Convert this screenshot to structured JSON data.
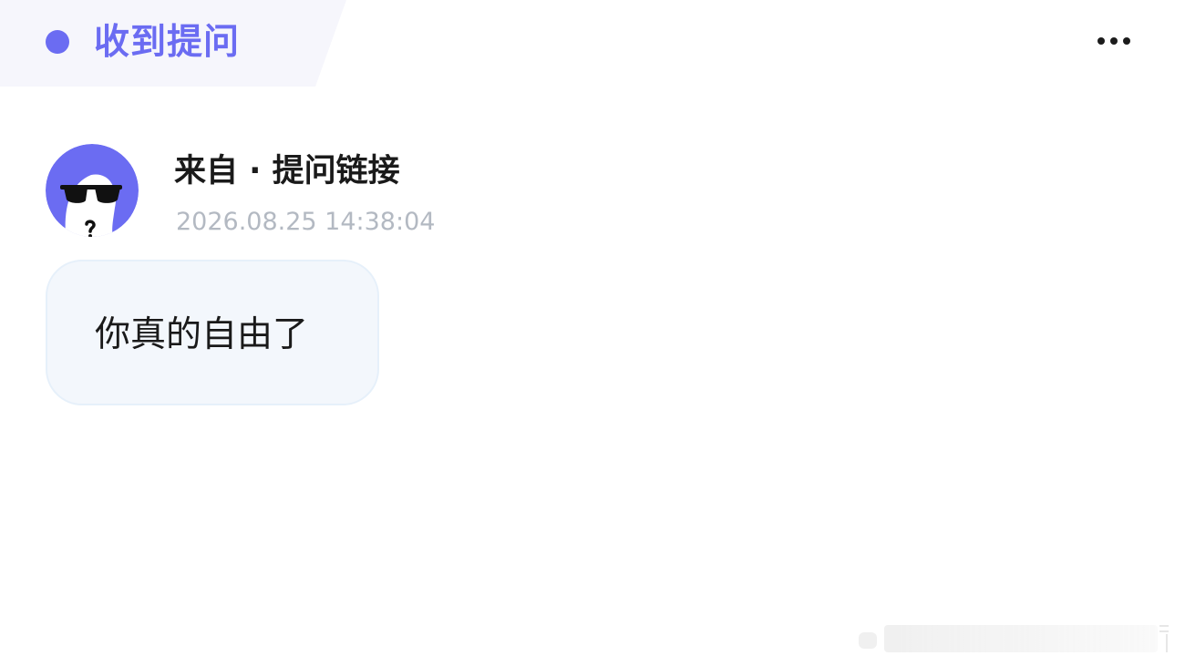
{
  "header": {
    "title": "收到提问",
    "more_icon": "more-horizontal-icon"
  },
  "message": {
    "avatar_icon": "sunglasses-question-avatar",
    "source": "来自 · 提问链接",
    "timestamp": "2026.08.25 14:38:04",
    "text": "你真的自由了"
  },
  "colors": {
    "accent": "#6b6cf2",
    "header_bg": "#f6f6fc",
    "bubble_bg": "#f3f7fc",
    "bubble_border": "#e6f0fa",
    "timestamp": "#b3b9c2",
    "text": "#1a1a1a"
  }
}
